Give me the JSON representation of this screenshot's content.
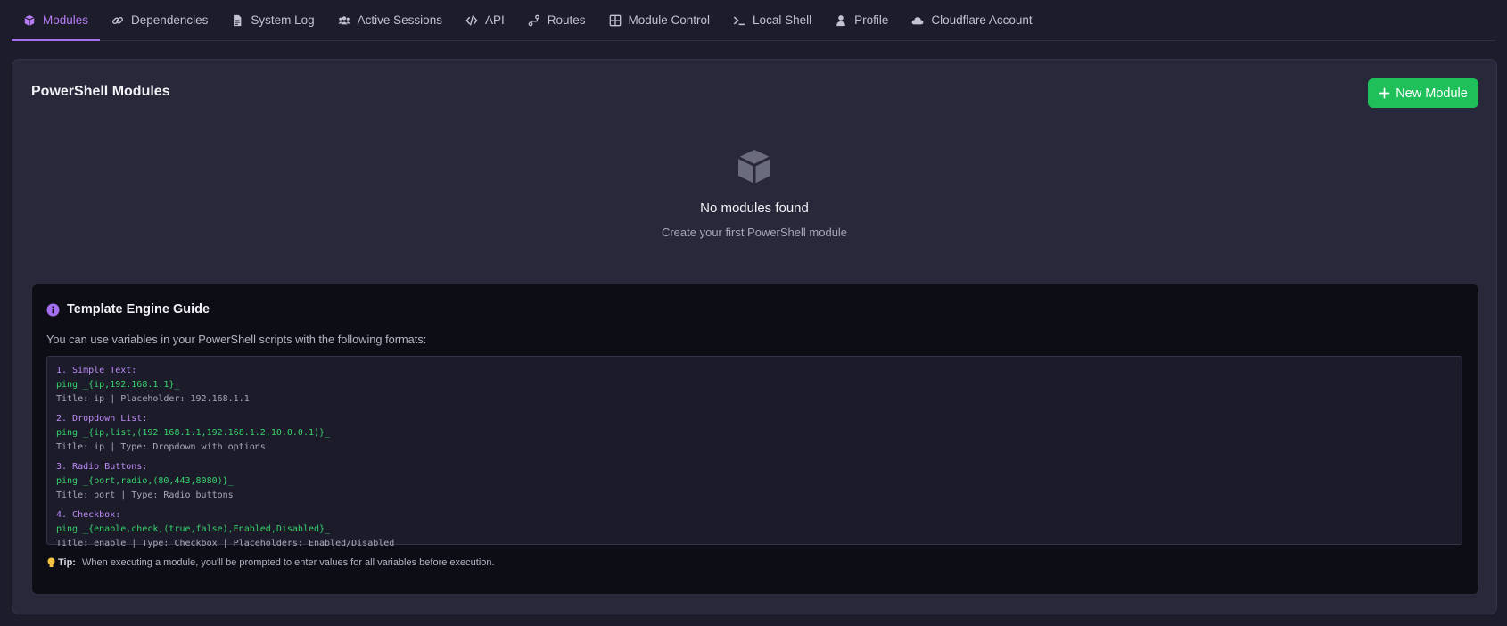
{
  "tabs": [
    {
      "label": "Modules",
      "icon": "cube-icon",
      "active": true
    },
    {
      "label": "Dependencies",
      "icon": "link-icon"
    },
    {
      "label": "System Log",
      "icon": "file-icon"
    },
    {
      "label": "Active Sessions",
      "icon": "users-icon"
    },
    {
      "label": "API",
      "icon": "code-icon"
    },
    {
      "label": "Routes",
      "icon": "route-icon"
    },
    {
      "label": "Module Control",
      "icon": "grid-icon"
    },
    {
      "label": "Local Shell",
      "icon": "terminal-icon"
    },
    {
      "label": "Profile",
      "icon": "user-icon"
    },
    {
      "label": "Cloudflare Account",
      "icon": "cloud-icon"
    }
  ],
  "panel": {
    "title": "PowerShell Modules",
    "new_button": "New Module"
  },
  "empty_state": {
    "icon": "cube-icon",
    "title": "No modules found",
    "subtitle": "Create your first PowerShell module"
  },
  "guide": {
    "title": "Template Engine Guide",
    "description": "You can use variables in your PowerShell scripts with the following formats:",
    "sections": [
      {
        "heading": "1. Simple Text:",
        "code": "ping _{ip,192.168.1.1}_",
        "note": "Title: ip | Placeholder: 192.168.1.1"
      },
      {
        "heading": "2. Dropdown List:",
        "code": "ping _{ip,list,(192.168.1.1,192.168.1.2,10.0.0.1)}_",
        "note": "Title: ip | Type: Dropdown with options"
      },
      {
        "heading": "3. Radio Buttons:",
        "code": "ping _{port,radio,(80,443,8080)}_",
        "note": "Title: port | Type: Radio buttons"
      },
      {
        "heading": "4. Checkbox:",
        "code": "ping _{enable,check,(true,false),Enabled,Disabled}_",
        "note": "Title: enable | Type: Checkbox | Placeholders: Enabled/Disabled"
      }
    ],
    "tip_label": "Tip:",
    "tip_text": "When executing a module, you'll be prompted to enter values for all variables before execution."
  },
  "colors": {
    "accent": "#a36ef0",
    "success": "#1fbf5a",
    "background": "#1c1c2b"
  }
}
